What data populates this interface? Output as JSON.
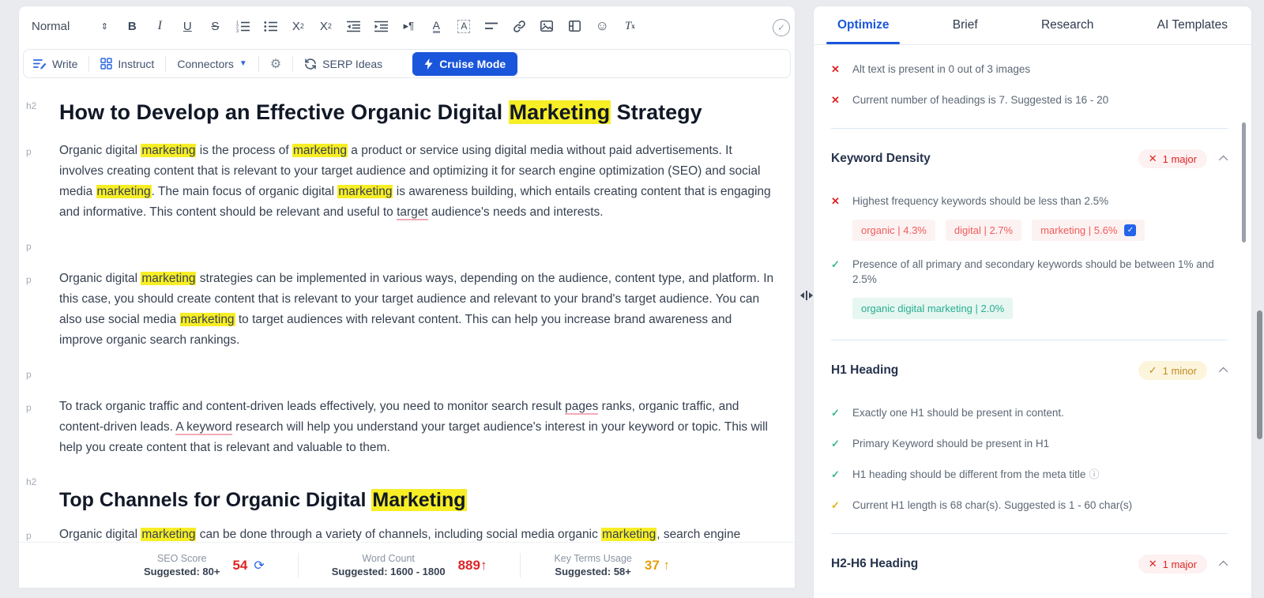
{
  "editor": {
    "format_dropdown": "Normal",
    "toolbar_icons": [
      "font-size-stepper-icon",
      "bold-icon",
      "italic-icon",
      "underline-icon",
      "strikethrough-icon",
      "ordered-list-icon",
      "bullet-list-icon",
      "subscript-icon",
      "superscript-icon",
      "outdent-icon",
      "indent-icon",
      "text-direction-icon",
      "text-color-icon",
      "highlight-color-icon",
      "align-icon",
      "link-icon",
      "image-icon",
      "video-icon",
      "emoji-icon",
      "clear-formatting-icon",
      "check-circle-icon"
    ],
    "actions": {
      "write": "Write",
      "instruct": "Instruct",
      "connectors": "Connectors",
      "serp_ideas": "SERP Ideas",
      "cruise_mode": "Cruise Mode"
    },
    "document": {
      "blocks": [
        {
          "tag": "h2",
          "cls": "h2a",
          "segments": [
            {
              "t": "How to Develop an Effective Organic Digital "
            },
            {
              "t": "Marketing",
              "m": "hl"
            },
            {
              "t": " Strategy"
            }
          ]
        },
        {
          "tag": "p",
          "cls": "para",
          "segments": [
            {
              "t": "Organic digital "
            },
            {
              "t": "marketing",
              "m": "hl"
            },
            {
              "t": " is the process of "
            },
            {
              "t": "marketing",
              "m": "hl"
            },
            {
              "t": " a product or service using digital media without paid advertisements. It involves creating content that is relevant to your target audience and optimizing it for search engine optimization (SEO) and social media "
            },
            {
              "t": "marketing",
              "m": "hl"
            },
            {
              "t": ". The main focus of organic digital "
            },
            {
              "t": "marketing",
              "m": "hl"
            },
            {
              "t": " is awareness building, which entails creating content that is engaging and informative. This content should be relevant and useful to "
            },
            {
              "t": "target",
              "m": "ul"
            },
            {
              "t": " audience's needs and interests."
            }
          ]
        },
        {
          "tag": "p",
          "cls": "para",
          "segments": []
        },
        {
          "tag": "p",
          "cls": "para",
          "segments": [
            {
              "t": "Organic digital "
            },
            {
              "t": "marketing",
              "m": "hl"
            },
            {
              "t": " strategies can be implemented in various ways, depending on the audience, content type, and platform. In this case, you should create content that is relevant to your target audience and relevant to your brand's target audience. You can also use social media "
            },
            {
              "t": "marketing",
              "m": "hl"
            },
            {
              "t": " to target audiences with relevant content. This can help you increase brand awareness and improve organic search rankings."
            }
          ]
        },
        {
          "tag": "p",
          "cls": "para",
          "segments": []
        },
        {
          "tag": "p",
          "cls": "para",
          "segments": [
            {
              "t": "To track organic traffic and content-driven leads effectively, you need to monitor search result "
            },
            {
              "t": "pages",
              "m": "ul"
            },
            {
              "t": " ranks, organic traffic, and content-driven leads. "
            },
            {
              "t": "A keyword",
              "m": "ul"
            },
            {
              "t": " research will help you understand your target audience's interest in your keyword or topic. This will help you create content that is relevant and valuable to them."
            }
          ]
        },
        {
          "tag": "h2",
          "cls": "h2b",
          "segments": [
            {
              "t": "Top Channels for Organic Digital "
            },
            {
              "t": "Marketing",
              "m": "hl"
            }
          ]
        },
        {
          "tag": "p",
          "cls": "para",
          "segments": [
            {
              "t": "Organic digital "
            },
            {
              "t": "marketing",
              "m": "hl"
            },
            {
              "t": " can be done through a variety of channels, including social media organic "
            },
            {
              "t": "marketing",
              "m": "hl"
            },
            {
              "t": ", search engine"
            }
          ]
        }
      ]
    },
    "footer": {
      "seo_score": {
        "label": "SEO Score",
        "suggested": "Suggested: 80+",
        "value": "54"
      },
      "word_count": {
        "label": "Word Count",
        "suggested": "Suggested: 1600 - 1800",
        "value": "889",
        "arrow": "↑"
      },
      "key_terms": {
        "label": "Key Terms Usage",
        "suggested": "Suggested: 58+",
        "value": "37",
        "arrow": "↑"
      }
    }
  },
  "panel": {
    "tabs": [
      "Optimize",
      "Brief",
      "Research",
      "AI Templates"
    ],
    "active_tab": "Optimize",
    "top_checks": [
      {
        "icon": "x",
        "text": "Alt text is present in 0 out of 3 images"
      },
      {
        "icon": "x",
        "text": "Current number of headings is 7. Suggested is 16 - 20"
      }
    ],
    "sections": [
      {
        "title": "Keyword Density",
        "badge": {
          "type": "major",
          "icon": "✕",
          "text": "1 major"
        },
        "items": [
          {
            "icon": "x",
            "text": "Highest frequency keywords should be less than 2.5%",
            "pills": [
              {
                "text": "organic | 4.3%",
                "type": "red"
              },
              {
                "text": "digital | 2.7%",
                "type": "red"
              },
              {
                "text": "marketing | 5.6%",
                "type": "red",
                "checkbox": true
              }
            ]
          },
          {
            "icon": "check-green",
            "text": "Presence of all primary and secondary keywords should be between 1% and 2.5%",
            "pills": [
              {
                "text": "organic digital marketing | 2.0%",
                "type": "green"
              }
            ]
          }
        ]
      },
      {
        "title": "H1 Heading",
        "badge": {
          "type": "minor",
          "icon": "✓",
          "text": "1 minor"
        },
        "items": [
          {
            "icon": "check-green",
            "text": "Exactly one H1 should be present in content."
          },
          {
            "icon": "check-green",
            "text": "Primary Keyword should be present in H1"
          },
          {
            "icon": "check-green",
            "text": "H1 heading should be different from the meta title",
            "info": true
          },
          {
            "icon": "check-yellow",
            "text": "Current H1 length is 68 char(s). Suggested is 1 - 60 char(s)"
          }
        ]
      },
      {
        "title": "H2-H6 Heading",
        "badge": {
          "type": "major",
          "icon": "✕",
          "text": "1 major"
        },
        "items": []
      }
    ]
  },
  "colors": {
    "accent_blue": "#1a56db",
    "major_red": "#e02424",
    "minor_amber": "#bf8b24",
    "success_green": "#3dba8c",
    "warning_yellow": "#e9b10e",
    "highlight_yellow": "#f7ee26",
    "underline_pink": "#f2abb8",
    "score_red": "#dc2626",
    "terms_amber": "#e3a008"
  }
}
